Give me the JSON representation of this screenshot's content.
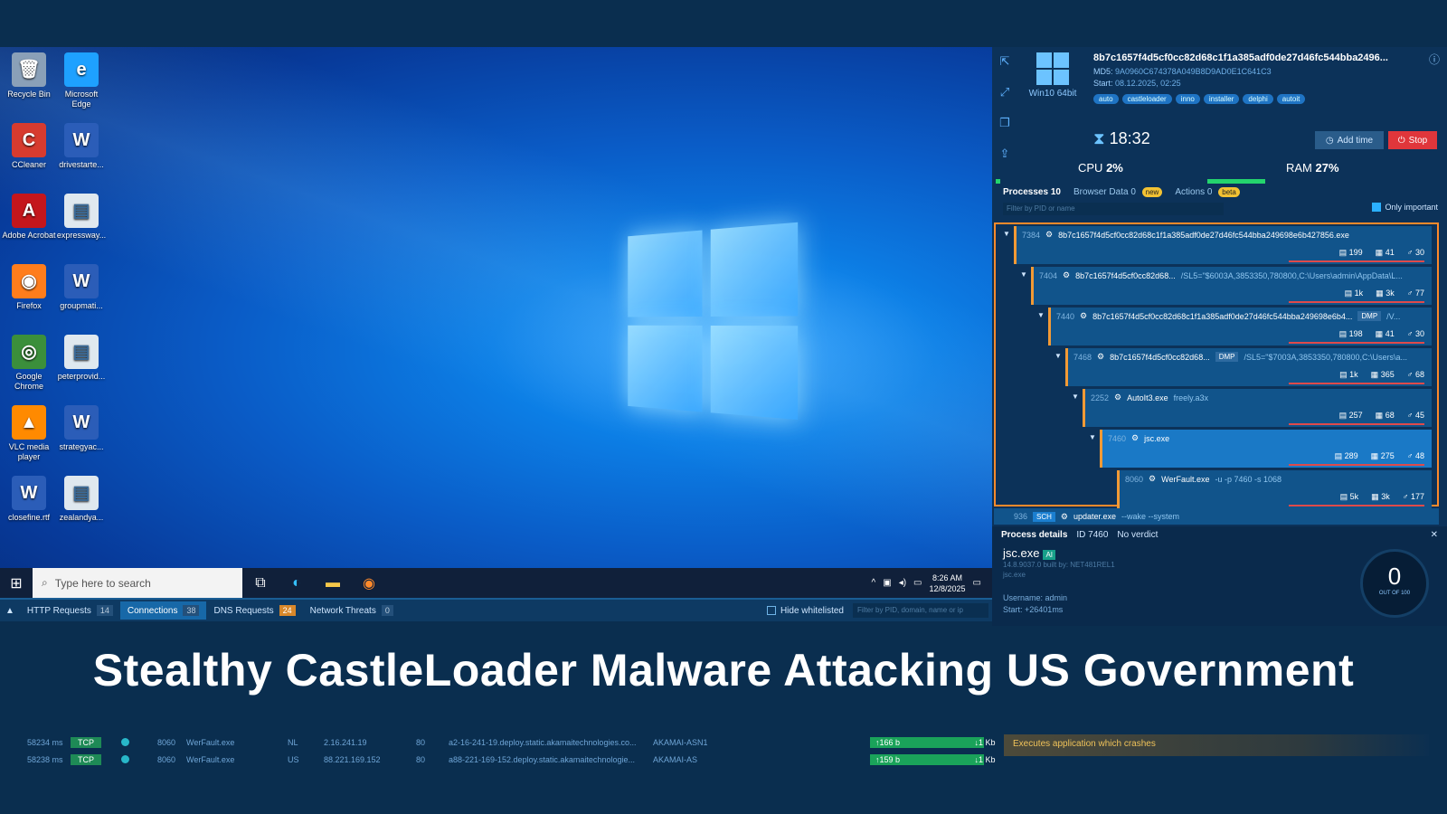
{
  "desktop": {
    "icons": [
      {
        "label": "Recycle Bin",
        "glyph": "🗑"
      },
      {
        "label": "Microsoft Edge",
        "glyph": "e"
      },
      {
        "label": "CCleaner",
        "glyph": "C"
      },
      {
        "label": "drivestarte...",
        "glyph": "W"
      },
      {
        "label": "Adobe Acrobat",
        "glyph": "A"
      },
      {
        "label": "expressway...",
        "glyph": "▤"
      },
      {
        "label": "Firefox",
        "glyph": "◉"
      },
      {
        "label": "groupmati...",
        "glyph": "W"
      },
      {
        "label": "Google Chrome",
        "glyph": "◎"
      },
      {
        "label": "peterprovid...",
        "glyph": "▤"
      },
      {
        "label": "VLC media player",
        "glyph": "▲"
      },
      {
        "label": "strategyac...",
        "glyph": "W"
      },
      {
        "label": "closefine.rtf",
        "glyph": "W"
      },
      {
        "label": "zealandya...",
        "glyph": "▤"
      }
    ]
  },
  "taskbar": {
    "search_placeholder": "Type here to search",
    "time": "8:26 AM",
    "date": "12/8/2025"
  },
  "netbar": {
    "tabs": [
      {
        "label": "HTTP Requests",
        "count": "14"
      },
      {
        "label": "Connections",
        "count": "38"
      },
      {
        "label": "DNS Requests",
        "count": "24"
      },
      {
        "label": "Network Threats",
        "count": "0"
      }
    ],
    "hide_whitelisted": "Hide whitelisted",
    "filter_placeholder": "Filter by PID, domain, name or ip"
  },
  "panel": {
    "os_label": "Win10 64bit",
    "hash": "8b7c1657f4d5cf0cc82d68c1f1a385adf0de27d46fc544bba2496...",
    "md5_label": "MD5:",
    "md5": "9A0960C674378A049B8D9AD0E1C641C3",
    "start_label": "Start:",
    "start": "08.12.2025, 02:25",
    "tags": [
      "auto",
      "castleloader",
      "inno",
      "installer",
      "delphi",
      "autoit"
    ],
    "timer": "18:32",
    "add_time": "Add time",
    "stop": "Stop",
    "cpu_label": "CPU",
    "cpu": "2%",
    "ram_label": "RAM",
    "ram": "27%",
    "tabs": {
      "processes": "Processes 10",
      "browser": "Browser Data",
      "browser_count": "0",
      "browser_badge": "new",
      "actions": "Actions",
      "actions_count": "0",
      "actions_badge": "beta"
    },
    "filter_placeholder": "Filter by PID or name",
    "only_important": "Only important",
    "processes": [
      {
        "pid": "7384",
        "name": "8b7c1657f4d5cf0cc82d68c1f1a385adf0de27d46fc544bba249698e6b427856.exe",
        "args": "",
        "dmp": "",
        "n1": "199",
        "n2": "41",
        "n3": "30"
      },
      {
        "pid": "7404",
        "name": "8b7c1657f4d5cf0cc82d68...",
        "args": "/SL5=\"$6003A,3853350,780800,C:\\Users\\admin\\AppData\\L...",
        "dmp": "",
        "n1": "1k",
        "n2": "3k",
        "n3": "77"
      },
      {
        "pid": "7440",
        "name": "8b7c1657f4d5cf0cc82d68c1f1a385adf0de27d46fc544bba249698e6b4...",
        "args": "/V...",
        "dmp": "DMP",
        "n1": "198",
        "n2": "41",
        "n3": "30"
      },
      {
        "pid": "7468",
        "name": "8b7c1657f4d5cf0cc82d68...",
        "args": "/SL5=\"$7003A,3853350,780800,C:\\Users\\a...",
        "dmp": "DMP",
        "n1": "1k",
        "n2": "365",
        "n3": "68"
      },
      {
        "pid": "2252",
        "name": "AutoIt3.exe",
        "args": "freely.a3x",
        "dmp": "",
        "n1": "257",
        "n2": "68",
        "n3": "45"
      },
      {
        "pid": "7460",
        "name": "jsc.exe",
        "args": "",
        "dmp": "",
        "n1": "289",
        "n2": "275",
        "n3": "48"
      },
      {
        "pid": "8060",
        "name": "WerFault.exe",
        "args": "-u -p 7460 -s 1068",
        "dmp": "",
        "n1": "5k",
        "n2": "3k",
        "n3": "177"
      }
    ],
    "updater": {
      "pid": "936",
      "badge": "SCH",
      "name": "updater.exe",
      "args": "--wake --system"
    },
    "details": {
      "title": "Process details",
      "id": "ID 7460",
      "verdict": "No verdict",
      "name": "jsc.exe",
      "ai": "AI",
      "version": "14.8.9037.0 built by: NET481REL1",
      "file": "jsc.exe",
      "username_label": "Username:",
      "username": "admin",
      "start_label": "Start:",
      "start": "+26401ms",
      "score": "0",
      "score_label": "OUT OF 100"
    }
  },
  "headline": "Stealthy CastleLoader Malware Attacking US Government",
  "connections": [
    {
      "time": "58234 ms",
      "proto": "TCP",
      "pid": "8060",
      "proc": "WerFault.exe",
      "flag": "NL",
      "ip": "2.16.241.19",
      "port": "80",
      "domain": "a2-16-241-19.deploy.static.akamaitechnologies.co...",
      "asn": "AKAMAI-ASN1",
      "up": "166 b",
      "down": "1 Kb"
    },
    {
      "time": "58238 ms",
      "proto": "TCP",
      "pid": "8060",
      "proc": "WerFault.exe",
      "flag": "US",
      "ip": "88.221.169.152",
      "port": "80",
      "domain": "a88-221-169-152.deploy.static.akamaitechnologie...",
      "asn": "AKAMAI-AS",
      "up": "159 b",
      "down": "1 Kb"
    }
  ],
  "threat": "Executes application which crashes"
}
